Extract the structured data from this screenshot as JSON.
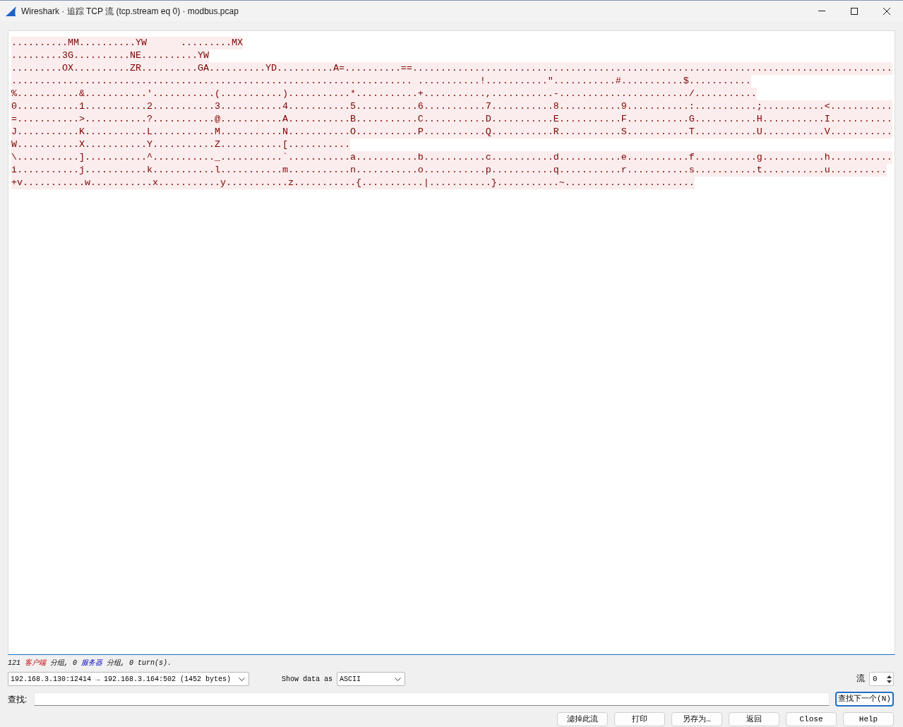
{
  "window": {
    "title": "Wireshark · 追踪 TCP 流 (tcp.stream eq 0) · modbus.pcap"
  },
  "stream_text": {
    "lines": [
      {
        "kind": "client",
        "text": "..........MM..........YW      .........MX"
      },
      {
        "kind": "client",
        "text": ".........3G..........NE..........YW"
      },
      {
        "kind": "client",
        "text": ".........OX..........ZR..........GA..........YD..........A=..........==....................................................................................."
      },
      {
        "kind": "client",
        "text": "....................................................................... ...........!...........\"...........#...........$..........."
      },
      {
        "kind": "client",
        "text": "%...........&...........'...........(...........)...........*...........+...........,...........-......................./..........."
      },
      {
        "kind": "client",
        "text": "0...........1...........2...........3...........4...........5...........6...........7...........8...........9...........:...........;...........<..........."
      },
      {
        "kind": "client",
        "text": "=...........>...........?...........@...........A...........B...........C...........D...........E...........F...........G...........H...........I..........."
      },
      {
        "kind": "client",
        "text": "J...........K...........L...........M...........N...........O...........P...........Q...........R...........S...........T...........U...........V..........."
      },
      {
        "kind": "client",
        "text": "W...........X...........Y...........Z...........[..........."
      },
      {
        "kind": "client",
        "text": "\\...........]...........^..........._...........`...........a...........b...........c...........d...........e...........f...........g...........h..........."
      },
      {
        "kind": "client",
        "text": "i...........j...........k...........l...........m...........n...........o...........p...........q...........r...........s...........t...........u.........."
      },
      {
        "kind": "client",
        "text": "+v...........w...........x...........y...........z...........{...........|...........}...........~......................."
      }
    ]
  },
  "summary": [
    {
      "text": "121",
      "kind": "plain"
    },
    {
      "text": "客户端",
      "kind": "client"
    },
    {
      "text": "分组, 0",
      "kind": "plain"
    },
    {
      "text": "服务器",
      "kind": "server"
    },
    {
      "text": "分组, 0 turn(s).",
      "kind": "plain"
    }
  ],
  "stream_select": {
    "value": "192.168.3.130:12414 → 192.168.3.164:502 (1452 bytes)"
  },
  "show_data_as": {
    "label": "Show data as",
    "value": "ASCII"
  },
  "stream_number": {
    "label": "流",
    "value": "0"
  },
  "find": {
    "label": "查找:",
    "button": "查找下一个(N)",
    "button_focused": true
  },
  "buttons": [
    "滤掉此流",
    "打印",
    "另存为…",
    "返回",
    "Close",
    "Help"
  ]
}
